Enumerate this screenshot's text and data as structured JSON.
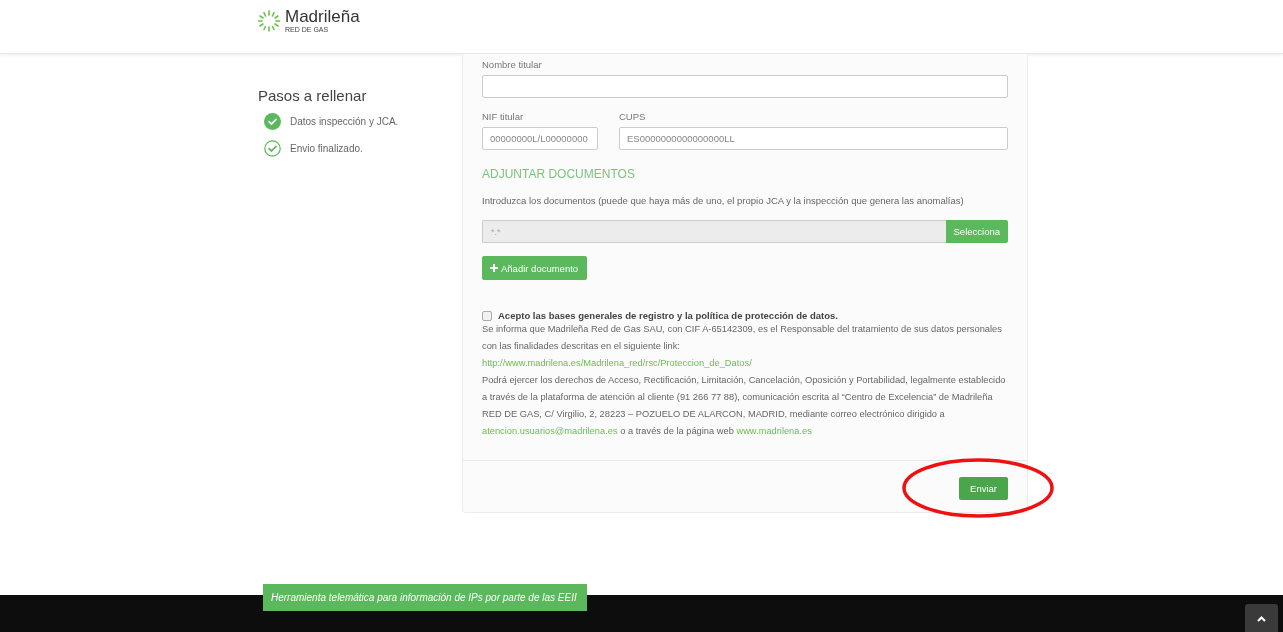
{
  "header": {
    "logo_name": "Madrileña",
    "logo_sub": "RED DE GAS"
  },
  "sidebar": {
    "title": "Pasos a rellenar",
    "steps": [
      {
        "label": "Datos inspección y JCA.",
        "done": true
      },
      {
        "label": "Envio finalizado.",
        "done": false
      }
    ]
  },
  "form": {
    "holder_name": {
      "label": "Nombre titular"
    },
    "nif": {
      "label": "NIF titular",
      "placeholder": "00000000L/L00000000"
    },
    "cups": {
      "label": "CUPS",
      "placeholder": "ES0000000000000000LL"
    },
    "attach_heading": "ADJUNTAR DOCUMENTOS",
    "attach_intro": "Introduzca los documentos (puede que haya más de uno, el propio JCA y la inspección que genera las anomalías)",
    "file": {
      "placeholder": "*.*",
      "button": "Selecciona"
    },
    "add_button": "Añadir documento",
    "consent": {
      "label": "Acepto las bases generales de registro y la política de protección de datos.",
      "checked": false
    },
    "notice": {
      "intro": "Se informa que Madrileña Red de Gas SAU, con CIF A-65142309, es el Responsable del tratamiento de sus datos personales con las finalidades descritas en el siguiente link:",
      "link": "http://www.madrilena.es/Madrilena_red/rsc/Proteccion_de_Datos/",
      "rights": "Podrá ejercer los derechos de Acceso, Rectificación, Limitación, Cancelación, Oposición y Portabilidad, legalmente establecido a través de la plataforma de atención al cliente (91 266 77 88), comunicación escrita al “Centro de Excelencia” de Madrileña RED DE GAS, C/ Virgilio, 2, 28223 – POZUELO DE ALARCON, MADRID, mediante correo electrónico dirigido a",
      "email": "atencion.usuarios@madrilena.es",
      "rights_middle": "o a través de la página web",
      "website": "www.madrilena.es"
    },
    "submit": {
      "label": "Enviar",
      "circled": true
    }
  },
  "footer": {
    "tagline": "Herramienta telemática para información de IPs por parte de las EEII"
  }
}
